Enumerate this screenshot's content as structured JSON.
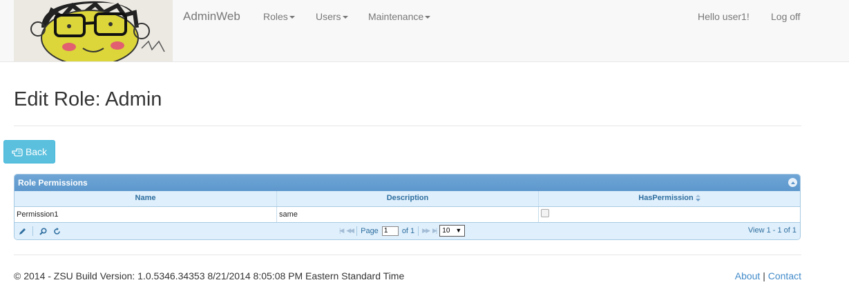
{
  "navbar": {
    "brand": "AdminWeb",
    "menu": [
      {
        "label": "Roles"
      },
      {
        "label": "Users"
      },
      {
        "label": "Maintenance"
      }
    ],
    "greeting": "Hello user1!",
    "logoff": "Log off"
  },
  "page": {
    "title": "Edit Role: Admin",
    "back_label": "Back"
  },
  "grid": {
    "caption": "Role Permissions",
    "columns": [
      "Name",
      "Description",
      "HasPermission"
    ],
    "rows": [
      {
        "name": "Permission1",
        "description": "same",
        "has_permission": false
      }
    ],
    "pager": {
      "page_label": "Page",
      "page_value": "1",
      "of_label": "of 1",
      "rows_per_page": "10",
      "view_text": "View 1 - 1 of 1"
    }
  },
  "footer": {
    "text": "© 2014 - ZSU Build Version: 1.0.5346.34353 8/21/2014 8:05:08 PM Eastern Standard Time",
    "about": "About",
    "separator": "|",
    "contact": "Contact"
  }
}
